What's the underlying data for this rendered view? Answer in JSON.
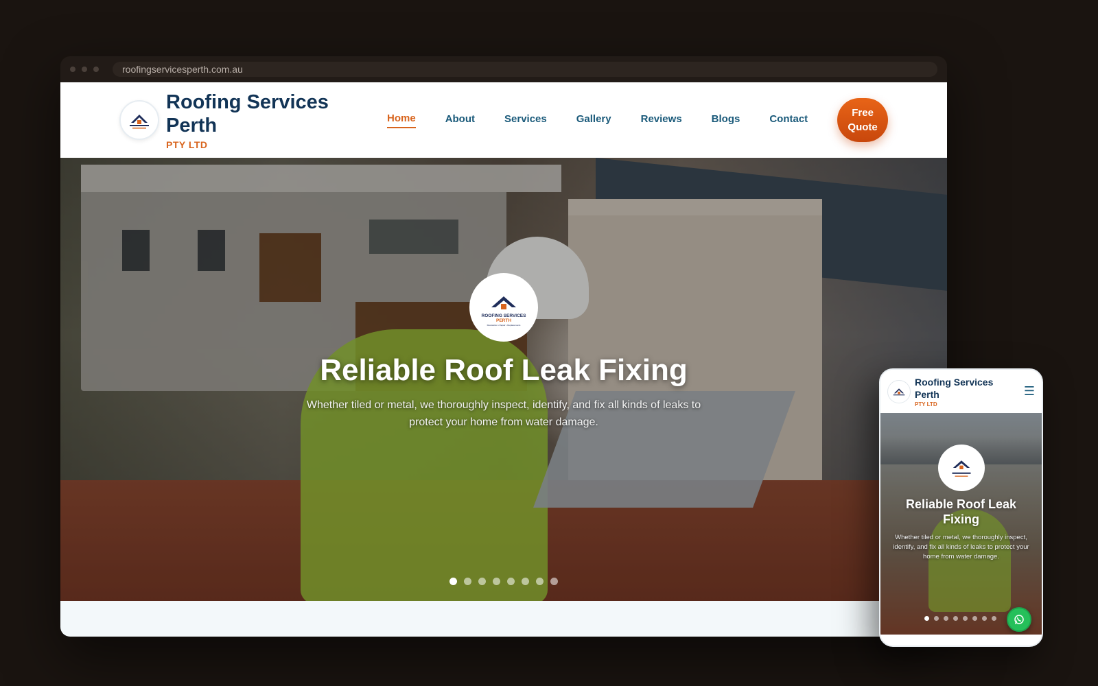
{
  "browser": {
    "url": "roofingservicesperth.com.au"
  },
  "site": {
    "brand_name": "Roofing Services Perth",
    "brand_sub": "PTY LTD",
    "nav": [
      "Home",
      "About",
      "Services",
      "Gallery",
      "Reviews",
      "Blogs",
      "Contact"
    ],
    "active_nav": "Home",
    "cta_label": "Free Quote",
    "accent_color": "#d8641d",
    "primary_color": "#123456"
  },
  "hero": {
    "title": "Reliable Roof Leak Fixing",
    "text": "Whether tiled or metal, we thoroughly inspect, identify, and fix all kinds of leaks to protect your home from water damage.",
    "slide_count": 8,
    "active_slide": 1
  },
  "mobile": {
    "brand_name": "Roofing Services Perth",
    "brand_sub": "PTY LTD",
    "menu_icon": "hamburger-icon",
    "hero_title": "Reliable Roof Leak Fixing",
    "hero_text": "Whether tiled or metal, we thoroughly inspect, identify, and fix all kinds of leaks to protect your home from water damage.",
    "whatsapp_icon": "whatsapp-icon"
  },
  "logo": {
    "line1": "ROOFING SERVICES",
    "line2": "PERTH",
    "tagline": "Restoration • Repair • Replacements"
  }
}
